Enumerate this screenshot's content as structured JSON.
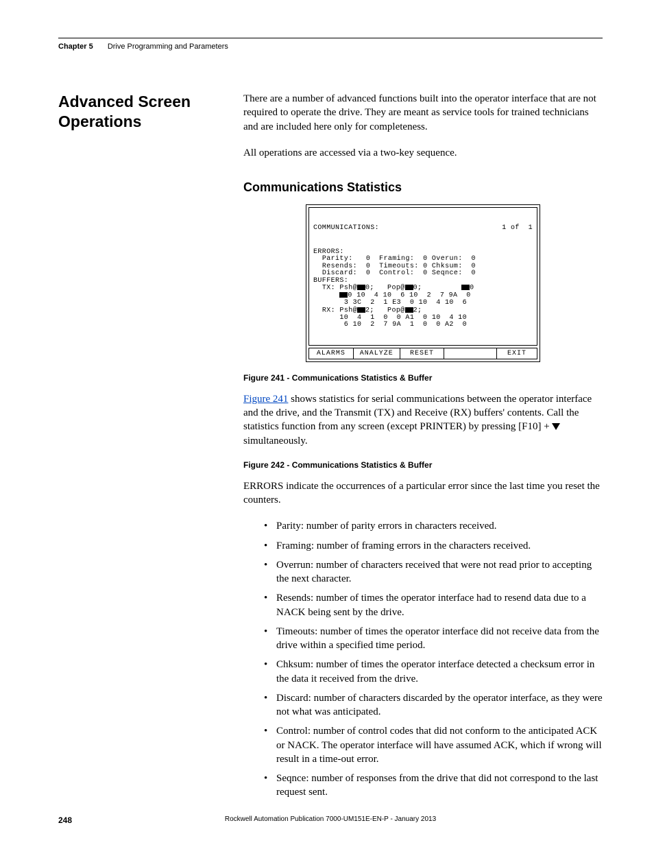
{
  "header": {
    "chapter": "Chapter 5",
    "title": "Drive Programming and Parameters"
  },
  "section_title_a": "Advanced Screen",
  "section_title_b": "Operations",
  "intro_para_1": "There are a number of advanced functions built into the operator interface that are not required to operate the drive. They are meant as service tools for trained technicians and are included here only for completeness.",
  "intro_para_2": "All operations are accessed via a two-key sequence.",
  "subhead": "Communications Statistics",
  "screen": {
    "title": "COMMUNICATIONS:",
    "page": "1 of  1",
    "errors_label": "ERRORS:",
    "parity_label": "Parity:",
    "parity_val": "0",
    "framing_label": "Framing:",
    "framing_val": "0",
    "overun_label": "Overun:",
    "overun_val": "0",
    "resends_label": "Resends:",
    "resends_val": "0",
    "timeouts_label": "Timeouts:",
    "timeouts_val": "0",
    "chksum_label": "Chksum:",
    "chksum_val": "0",
    "discard_label": "Discard:",
    "discard_val": "0",
    "control_label": "Control:",
    "control_val": "0",
    "seqnce_label": "Seqnce:",
    "seqnce_val": "0",
    "buffers_label": "BUFFERS:",
    "tx_label": "TX:",
    "rx_label": "RX:",
    "tx_line1_a": "Psh@",
    "tx_line1_b": "0;",
    "tx_line1_c": "Pop@",
    "tx_line1_d": "0;",
    "tx_line2": "0 10  4 10  6 10  2  7 9A  0",
    "tx_line3": "3 3C  2  1 E3  0 10  4 10  6",
    "rx_line1_a": "Psh@",
    "rx_line1_b": "2;",
    "rx_line1_c": "Pop@",
    "rx_line1_d": "2;",
    "rx_line2": "10  4  1  0  0 A1  0 10  4 10",
    "rx_line3": " 6 10  2  7 9A  1  0  0 A2  0",
    "btn_alarms": "ALARMS",
    "btn_analyze": "ANALYZE",
    "btn_reset": "RESET",
    "btn_exit": "EXIT"
  },
  "fig241_caption": "Figure 241 - Communications Statistics & Buffer",
  "fig241_link": "Figure 241",
  "fig241_para_rest": " shows statistics for serial communications between the operator interface and the drive, and the Transmit (TX) and Receive (RX) buffers' contents. Call the statistics function from any screen (except PRINTER) by pressing [F10] + ",
  "fig241_para_tail": "  simultaneously.",
  "fig242_caption": "Figure 242 - Communications Statistics & Buffer",
  "errors_intro": "ERRORS indicate the occurrences of a particular error since the last time you reset the counters.",
  "bullets": [
    "Parity: number of parity errors in characters received.",
    "Framing: number of framing errors in the characters received.",
    "Overrun: number of characters received that were not read prior to accepting the next character.",
    "Resends: number of times the operator interface had to resend data due to a NACK being sent by the drive.",
    "Timeouts: number of times the operator interface did not receive data from the drive within a specified time period.",
    "Chksum: number of times the operator interface detected a checksum error in the data it received from the drive.",
    "Discard: number of characters discarded by the operator interface, as they were not what was anticipated.",
    "Control: number of control codes that did not conform to the anticipated ACK or NACK. The operator interface will have assumed ACK, which if wrong will result in a time-out error.",
    "Seqnce: number of responses from the drive that did not correspond to the last request sent."
  ],
  "footer": {
    "page": "248",
    "publication": "Rockwell Automation Publication 7000-UM151E-EN-P - January 2013"
  }
}
